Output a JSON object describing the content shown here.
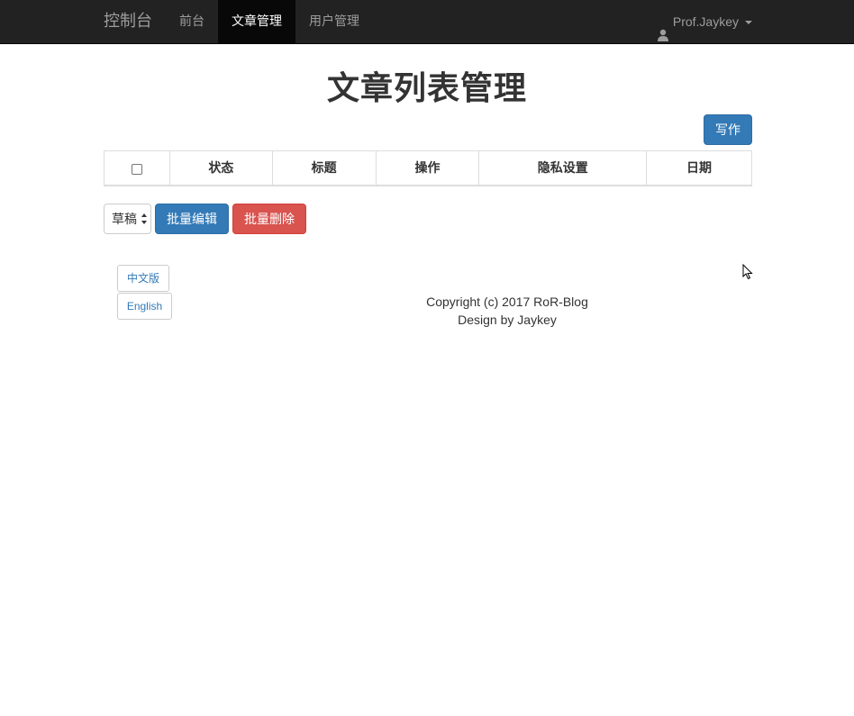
{
  "navbar": {
    "brand": "控制台",
    "items": [
      {
        "label": "前台",
        "active": false
      },
      {
        "label": "文章管理",
        "active": true
      },
      {
        "label": "用户管理",
        "active": false
      }
    ],
    "user": {
      "icon": "user-icon",
      "name": "Prof.Jaykey"
    }
  },
  "main": {
    "title": "文章列表管理",
    "write_button": "写作",
    "table": {
      "headers": [
        "状态",
        "标题",
        "操作",
        "隐私设置",
        "日期"
      ]
    },
    "batch": {
      "select_value": "草稿",
      "edit_button": "批量编辑",
      "delete_button": "批量删除"
    }
  },
  "footer": {
    "lang_zh": "中文版",
    "lang_en": "English",
    "copyright": "Copyright (c) 2017 RoR-Blog",
    "design": "Design by Jaykey"
  },
  "colors": {
    "navbar_bg": "#222222",
    "primary": "#337ab7",
    "danger": "#d9534f"
  }
}
